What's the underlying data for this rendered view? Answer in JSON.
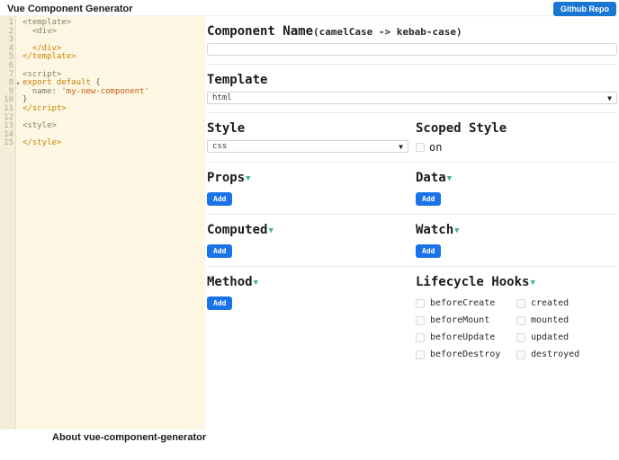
{
  "header": {
    "title": "Vue Component Generator",
    "github_button": "Github Repo"
  },
  "editor": {
    "lines": [
      {
        "num": "1",
        "segments": [
          {
            "t": "<template>",
            "c": "t-open"
          }
        ]
      },
      {
        "num": "2",
        "segments": [
          {
            "t": "  <div>",
            "c": "t-open"
          }
        ]
      },
      {
        "num": "3",
        "segments": []
      },
      {
        "num": "4",
        "segments": [
          {
            "t": "  </div>",
            "c": "t-close"
          }
        ]
      },
      {
        "num": "5",
        "segments": [
          {
            "t": "</template>",
            "c": "t-close"
          }
        ]
      },
      {
        "num": "6",
        "segments": []
      },
      {
        "num": "7",
        "segments": [
          {
            "t": "<script>",
            "c": "t-open"
          }
        ]
      },
      {
        "num": "8",
        "fold": true,
        "segments": [
          {
            "t": "export default",
            "c": "kw"
          },
          {
            "t": " {",
            "c": "punct"
          }
        ]
      },
      {
        "num": "9",
        "segments": [
          {
            "t": "  name: ",
            "c": "prop"
          },
          {
            "t": "'my-new-component'",
            "c": "str"
          }
        ]
      },
      {
        "num": "10",
        "segments": [
          {
            "t": "}",
            "c": "punct"
          }
        ]
      },
      {
        "num": "11",
        "segments": [
          {
            "t": "</script>",
            "c": "t-close"
          }
        ]
      },
      {
        "num": "12",
        "segments": []
      },
      {
        "num": "13",
        "segments": [
          {
            "t": "<style>",
            "c": "t-open"
          }
        ]
      },
      {
        "num": "14",
        "segments": []
      },
      {
        "num": "15",
        "segments": [
          {
            "t": "</style>",
            "c": "t-close"
          }
        ]
      }
    ]
  },
  "form": {
    "component_name": {
      "label": "Component Name",
      "hint": "(camelCase -> kebab-case)",
      "value": ""
    },
    "template": {
      "label": "Template",
      "value": "html"
    },
    "style": {
      "label": "Style",
      "value": "css"
    },
    "scoped_style": {
      "label": "Scoped Style",
      "checkbox_label": "on",
      "checked": false
    },
    "props": {
      "label": "Props",
      "add": "Add"
    },
    "data": {
      "label": "Data",
      "add": "Add"
    },
    "computed": {
      "label": "Computed",
      "add": "Add"
    },
    "watch": {
      "label": "Watch",
      "add": "Add"
    },
    "method": {
      "label": "Method",
      "add": "Add"
    },
    "lifecycle": {
      "label": "Lifecycle Hooks",
      "hooks": [
        "beforeCreate",
        "created",
        "beforeMount",
        "mounted",
        "beforeUpdate",
        "updated",
        "beforeDestroy",
        "destroyed"
      ]
    }
  },
  "footer": {
    "about": "About vue-component-generator"
  },
  "colors": {
    "accent_blue": "#1a73e8",
    "vue_green": "#42b883",
    "editor_bg": "#fdf6e3"
  }
}
